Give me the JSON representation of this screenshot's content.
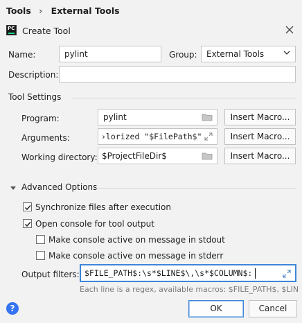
{
  "breadcrumb": {
    "root": "Tools",
    "current": "External Tools"
  },
  "dialog": {
    "logo_text": "PC",
    "title": "Create Tool"
  },
  "form": {
    "name_label": "Name:",
    "name_value": "pylint",
    "group_label": "Group:",
    "group_value": "External Tools",
    "description_label": "Description:",
    "description_value": ""
  },
  "tool_settings": {
    "section_title": "Tool Settings",
    "program_label": "Program:",
    "program_value": "pylint",
    "arguments_label": "Arguments:",
    "arguments_value": "›lorized \"$FilePath$\"",
    "workdir_label": "Working directory:",
    "workdir_value": "$ProjectFileDir$",
    "insert_macro_label": "Insert Macro..."
  },
  "advanced": {
    "section_title": "Advanced Options",
    "sync_label": "Synchronize files after execution",
    "sync_checked": true,
    "console_label": "Open console for tool output",
    "console_checked": true,
    "stdout_label": "Make console active on message in stdout",
    "stdout_checked": false,
    "stderr_label": "Make console active on message in stderr",
    "stderr_checked": false,
    "filters_label": "Output filters:",
    "filters_value": "$FILE_PATH$:\\s*$LINE$\\,\\s*$COLUMN$:",
    "hint": "Each line is a regex, available macros: $FILE_PATH$, $LINE$ a..."
  },
  "footer": {
    "help_label": "?",
    "ok_label": "OK",
    "cancel_label": "Cancel"
  },
  "colors": {
    "accent": "#3e86d6",
    "help": "#3574f0",
    "background": "#f2f2f2"
  },
  "icons": [
    "chevron-right-icon",
    "pycharm-logo-icon",
    "close-icon",
    "chevron-down-icon",
    "folder-icon",
    "expand-icon",
    "triangle-down-icon",
    "checkmark-icon",
    "help-icon"
  ]
}
